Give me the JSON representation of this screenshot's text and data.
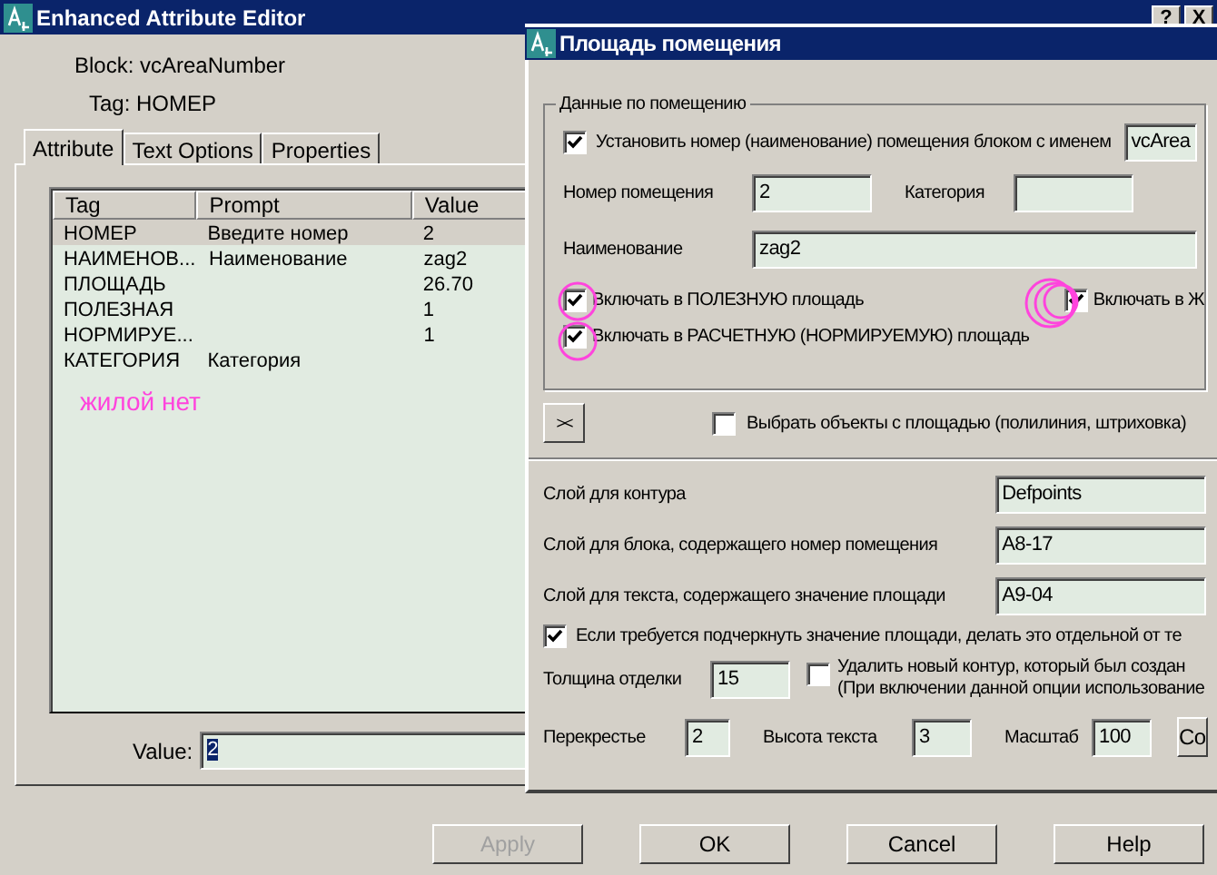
{
  "back_window": {
    "title": "Enhanced Attribute Editor",
    "title_buttons": [
      "?",
      "X"
    ],
    "block": "Block: vcAreaNumber",
    "tag": "Tag: НОМЕР",
    "tabs": [
      {
        "label": "Attribute",
        "selected": true
      },
      {
        "label": "Text Options",
        "selected": false
      },
      {
        "label": "Properties",
        "selected": false
      }
    ],
    "attribute_list": {
      "columns": [
        "Tag",
        "Prompt",
        "Value"
      ],
      "rows": [
        {
          "cells": [
            "НОМЕР",
            "Введите номер",
            "2"
          ],
          "selected": true
        },
        {
          "cells": [
            "НАИМЕНОВ...",
            "Наименование",
            "zag2"
          ],
          "selected": false
        },
        {
          "cells": [
            "ПЛОЩАДЬ",
            "",
            "26.70"
          ],
          "selected": false
        },
        {
          "cells": [
            "ПОЛЕЗНАЯ",
            "",
            "1"
          ],
          "selected": false
        },
        {
          "cells": [
            "НОРМИРУЕ...",
            "",
            "1"
          ],
          "selected": false
        },
        {
          "cells": [
            "КАТЕГОРИЯ",
            "Категория",
            ""
          ],
          "selected": false
        }
      ]
    },
    "annotation": "жилой нет",
    "value_field": {
      "label": "Value:",
      "value": "2"
    },
    "buttons": [
      {
        "label": "Apply",
        "disabled": true
      },
      {
        "label": "OK",
        "disabled": false
      },
      {
        "label": "Cancel",
        "disabled": false
      },
      {
        "label": "Help",
        "disabled": false
      }
    ]
  },
  "front_window": {
    "title": "Площадь помещения",
    "group": {
      "title": "Данные по помещению",
      "set_block": {
        "label": "Установить номер (наименование) помещения блоком с именем",
        "checked": true,
        "value": "vcArea"
      },
      "room_number": {
        "label": "Номер помещения",
        "value": "2"
      },
      "category": {
        "label": "Категория"
      },
      "name": {
        "label": "Наименование",
        "value": "zag2"
      },
      "include_useful": {
        "label": "Включать в ПОЛЕЗНУЮ площадь",
        "checked": true
      },
      "include_living": {
        "label": "Включать в Ж",
        "checked": true
      },
      "include_calc": {
        "label": "Включать в РАСЧЕТНУЮ (НОРМИРУЕМУЮ) площадь",
        "checked": true
      }
    },
    "pick_button": "><",
    "select_objects": {
      "label": "Выбрать объекты с площадью (полилиния, штриховка)",
      "checked": false
    },
    "layers": [
      {
        "label": "Слой для контура",
        "value": "Defpoints"
      },
      {
        "label": "Слой для блока, содержащего номер помещения",
        "value": "А8-17"
      },
      {
        "label": "Слой для текста, содержащего значение площади",
        "value": "А9-04"
      }
    ],
    "underline": {
      "label": "Если требуется подчеркнуть значение площади, делать это отдельной от те",
      "checked": true
    },
    "finish_thickness": {
      "label": "Толщина отделки",
      "value": "15"
    },
    "delete_contour": {
      "lines": [
        "Удалить новый контур, который был создан",
        "(При включении данной опции использование"
      ],
      "checked": false
    },
    "bottom_fields": [
      {
        "label": "Перекрестье",
        "value": "2"
      },
      {
        "label": "Высота текста",
        "value": "3"
      },
      {
        "label": "Масштаб",
        "value": "100"
      }
    ],
    "cut_button": "Co"
  }
}
